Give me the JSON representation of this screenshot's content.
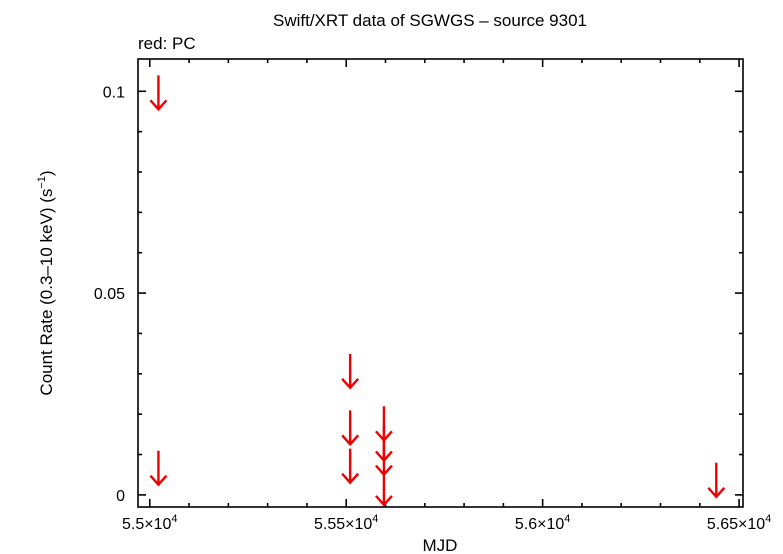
{
  "chart_data": {
    "type": "scatter",
    "title": "Swift/XRT data of SGWGS – source 9301",
    "subtitle": "red: PC",
    "xlabel": "MJD",
    "ylabel_main": "Count Rate (0.3–10 keV) (s",
    "ylabel_sup": "−1",
    "ylabel_end": ")",
    "xlim": [
      54970,
      56510
    ],
    "ylim": [
      -0.003,
      0.108
    ],
    "x_ticks": [
      {
        "value": 55000,
        "mantissa": "5.5×10",
        "exp": "4"
      },
      {
        "value": 55500,
        "mantissa": "5.55×10",
        "exp": "4"
      },
      {
        "value": 56000,
        "mantissa": "5.6×10",
        "exp": "4"
      },
      {
        "value": 56500,
        "mantissa": "5.65×10",
        "exp": "4"
      }
    ],
    "y_ticks": [
      {
        "value": 0,
        "label": "0"
      },
      {
        "value": 0.05,
        "label": "0.05"
      },
      {
        "value": 0.1,
        "label": "0.1"
      }
    ],
    "series": [
      {
        "color": "#ee0000",
        "marker": "upper-limit-arrow",
        "x": [
          55022,
          55022,
          55510,
          55510,
          55510,
          55596,
          55596,
          55596,
          55596,
          56442
        ],
        "y": [
          0.0985,
          0.0055,
          0.0295,
          0.0155,
          0.006,
          0.0165,
          0.0115,
          0.008,
          0.0005,
          0.0025
        ]
      }
    ],
    "grid": false,
    "legend": "none"
  }
}
